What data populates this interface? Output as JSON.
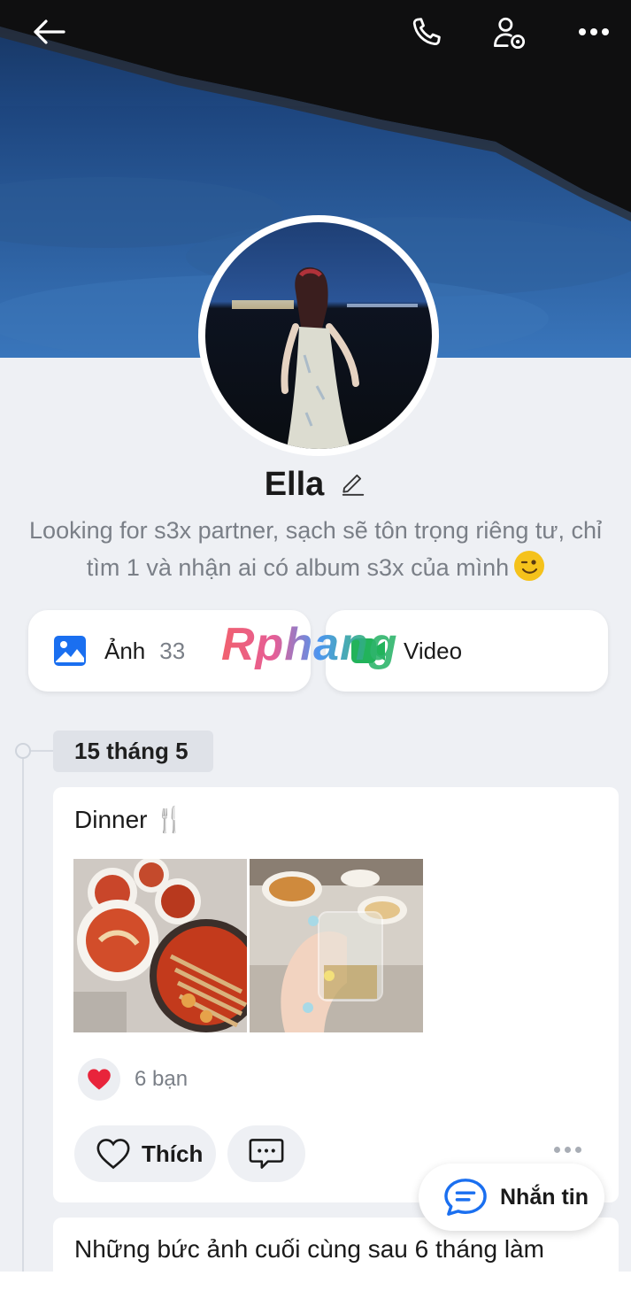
{
  "header": {
    "back_icon": "arrow-left-icon",
    "call_icon": "phone-icon",
    "profile_settings_icon": "user-gear-icon",
    "more_icon": "more-horizontal-icon"
  },
  "profile": {
    "name": "Ella",
    "edit_icon": "pencil-icon",
    "bio": "Looking for s3x partner, sạch sẽ tôn trọng riêng tư, chỉ tìm 1 và nhận ai có album s3x của mình"
  },
  "media": {
    "photos": {
      "label": "Ảnh",
      "count": "33",
      "icon": "image-icon"
    },
    "videos": {
      "label": "Video",
      "icon": "video-icon"
    }
  },
  "watermark": "Rphang",
  "timeline": {
    "date": "15 tháng 5",
    "post": {
      "title": "Dinner 🍴",
      "reactions": "6 bạn",
      "like_label": "Thích",
      "comment_icon": "comment-icon"
    },
    "next_post_title": "Những bức ảnh cuối cùng sau 6 tháng làm"
  },
  "chat_button": {
    "label": "Nhắn tin",
    "icon": "chat-bubble-icon"
  },
  "colors": {
    "accent": "#1a6ff0",
    "heart": "#e8243b",
    "background": "#eef0f4"
  }
}
